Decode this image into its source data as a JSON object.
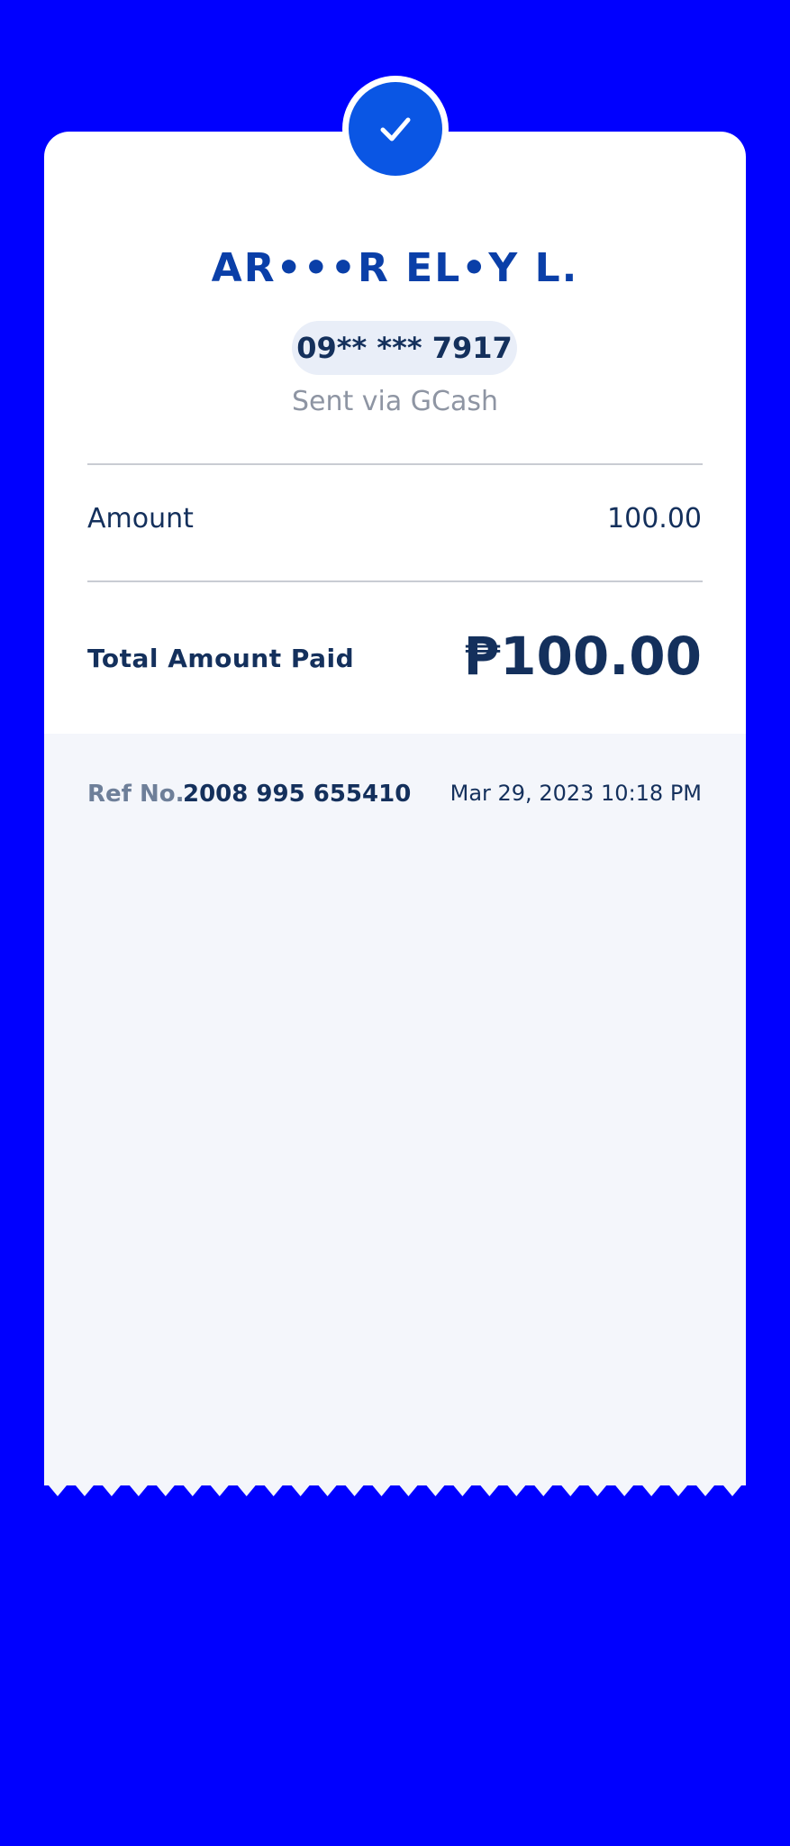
{
  "colors": {
    "background": "#0000FF",
    "card": "#FFFFFF",
    "card_footer": "#F4F6FB",
    "accent": "#0A56E4",
    "name_text": "#0A3FA8",
    "primary_text": "#14305C",
    "muted_text": "#8E95A3"
  },
  "header": {
    "status_icon": "check-icon"
  },
  "recipient": {
    "name": "AR•••R EL•Y L.",
    "phone": "09** *** 7917",
    "channel": "Sent via GCash"
  },
  "summary": {
    "amount_label": "Amount",
    "amount_value": "100.00",
    "total_label": "Total Amount Paid",
    "total_value": "₱100.00"
  },
  "footer": {
    "ref_label": "Ref No.",
    "ref_number": "2008 995 655410",
    "datetime": "Mar 29, 2023 10:18 PM"
  }
}
